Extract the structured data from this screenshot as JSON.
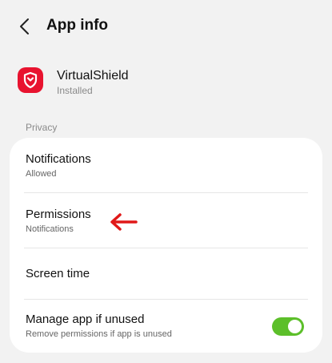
{
  "header": {
    "title": "App info",
    "back_icon": "chevron-left-icon"
  },
  "app": {
    "name": "VirtualShield",
    "status": "Installed",
    "icon": "shield-icon",
    "icon_color": "#e8132f"
  },
  "section": {
    "label": "Privacy"
  },
  "items": [
    {
      "title": "Notifications",
      "subtitle": "Allowed"
    },
    {
      "title": "Permissions",
      "subtitle": "Notifications"
    },
    {
      "title": "Screen time",
      "subtitle": ""
    },
    {
      "title": "Manage app if unused",
      "subtitle": "Remove permissions if app is unused",
      "toggle_on": true
    }
  ],
  "annotation": {
    "icon": "arrow-left-icon",
    "color": "#e01818"
  },
  "colors": {
    "background": "#f2f2f2",
    "card": "#ffffff",
    "toggle_on": "#5cbf2a"
  }
}
